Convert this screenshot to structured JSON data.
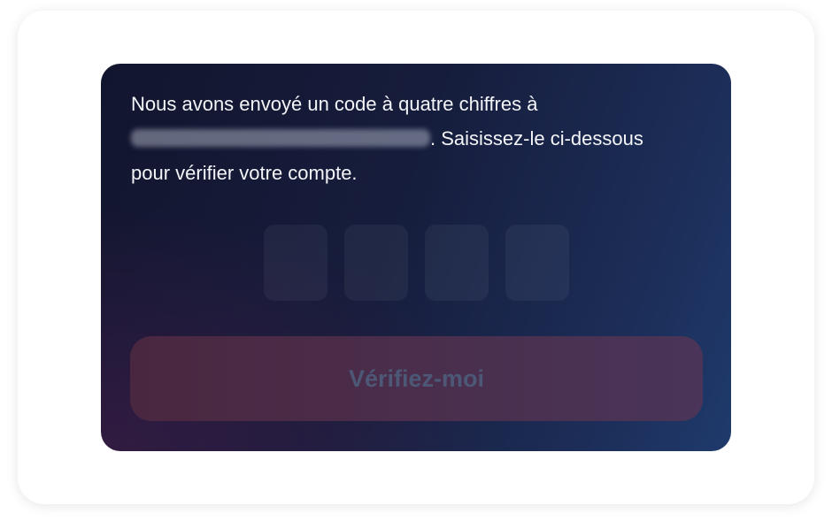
{
  "verification": {
    "message_line1": "Nous avons envoyé un code à quatre chiffres à",
    "message_after_email": ". Saisissez-le ci-dessous",
    "message_line3": "pour vérifier votre compte.",
    "code_digits": [
      "",
      "",
      "",
      ""
    ],
    "verify_button_label": "Vérifiez-moi"
  }
}
